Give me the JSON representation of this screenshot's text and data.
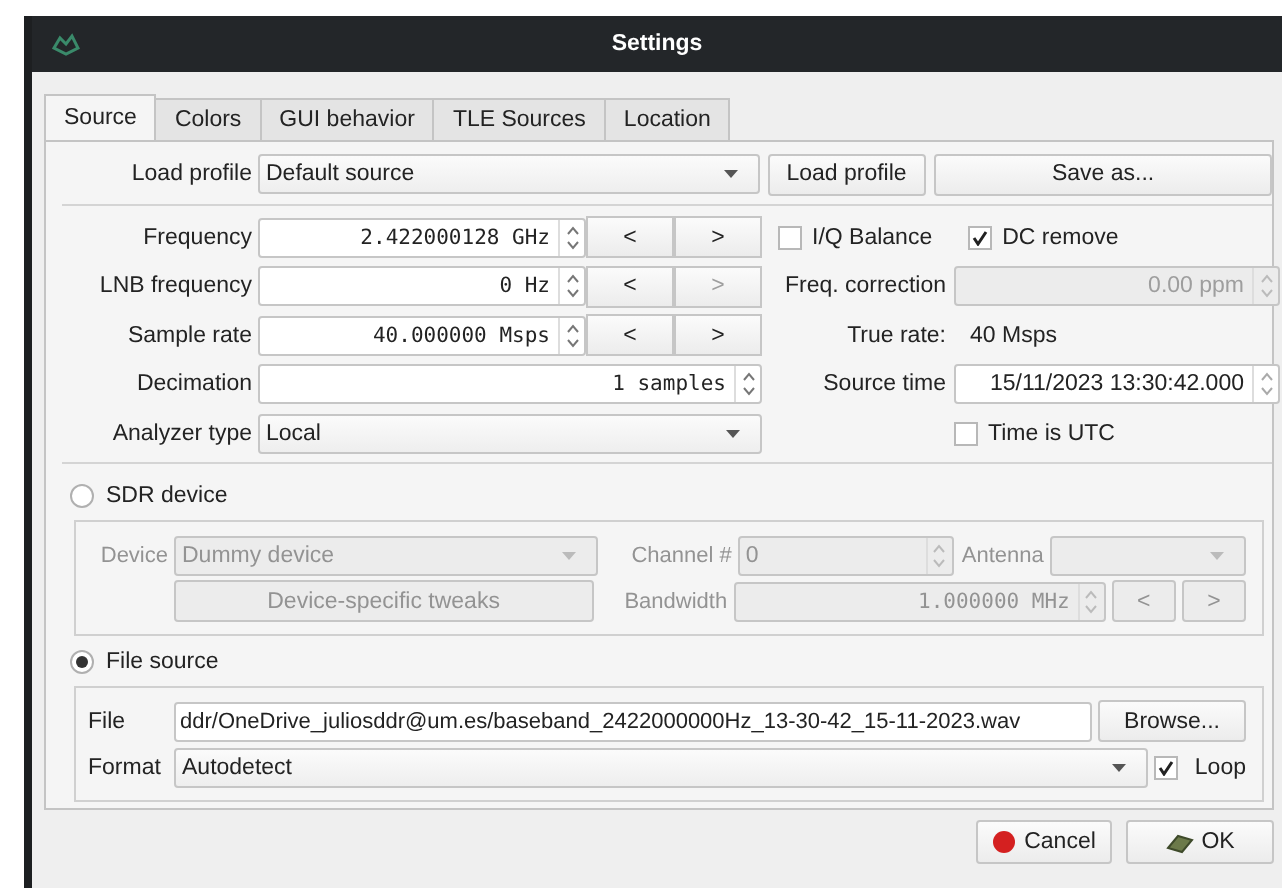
{
  "window": {
    "title": "Settings"
  },
  "tabs": [
    {
      "label": "Source",
      "selected": true
    },
    {
      "label": "Colors",
      "selected": false
    },
    {
      "label": "GUI behavior",
      "selected": false
    },
    {
      "label": "TLE Sources",
      "selected": false
    },
    {
      "label": "Location",
      "selected": false
    }
  ],
  "load_profile": {
    "label": "Load profile",
    "value": "Default source",
    "load_button": "Load profile",
    "save_button": "Save as..."
  },
  "rows": [
    {
      "kind": "spin_nav",
      "label": "Frequency",
      "value": "2.422000128 GHz",
      "prev": "<",
      "next": ">",
      "next_disabled": false
    },
    {
      "kind": "spin_nav",
      "label": "LNB frequency",
      "value": "0 Hz",
      "prev": "<",
      "next": ">",
      "next_disabled": true
    },
    {
      "kind": "spin_nav",
      "label": "Sample rate",
      "value": "40.000000 Msps",
      "prev": "<",
      "next": ">",
      "next_disabled": false
    },
    {
      "kind": "spin",
      "label": "Decimation",
      "value": "1 samples"
    },
    {
      "kind": "combo",
      "label": "Analyzer type",
      "value": "Local"
    }
  ],
  "iq_balance": {
    "label": "I/Q Balance",
    "checked": false
  },
  "dc_remove": {
    "label": "DC remove",
    "checked": true
  },
  "freq_correction": {
    "label": "Freq. correction",
    "value": "0.00 ppm",
    "disabled": true
  },
  "true_rate": {
    "label": "True rate:",
    "value": "40 Msps"
  },
  "source_time": {
    "label": "Source time",
    "value": "15/11/2023 13:30:42.000"
  },
  "time_is_utc": {
    "label": "Time is UTC",
    "checked": false
  },
  "sdr_device": {
    "label": "SDR device",
    "selected": false,
    "device_label": "Device",
    "device": "Dummy device",
    "channel_label": "Channel #",
    "channel": "0",
    "antenna_label": "Antenna",
    "tweaks_button": "Device-specific tweaks",
    "bandwidth_label": "Bandwidth",
    "bandwidth": "1.000000 MHz",
    "prev": "<",
    "next": ">"
  },
  "file_source": {
    "label": "File source",
    "selected": true,
    "file_label": "File",
    "path": "ddr/OneDrive_juliosddr@um.es/baseband_2422000000Hz_13-30-42_15-11-2023.wav",
    "browse_button": "Browse...",
    "format_label": "Format",
    "format": "Autodetect",
    "loop": {
      "label": "Loop",
      "checked": true
    }
  },
  "buttons": {
    "cancel": "Cancel",
    "ok": "OK"
  }
}
